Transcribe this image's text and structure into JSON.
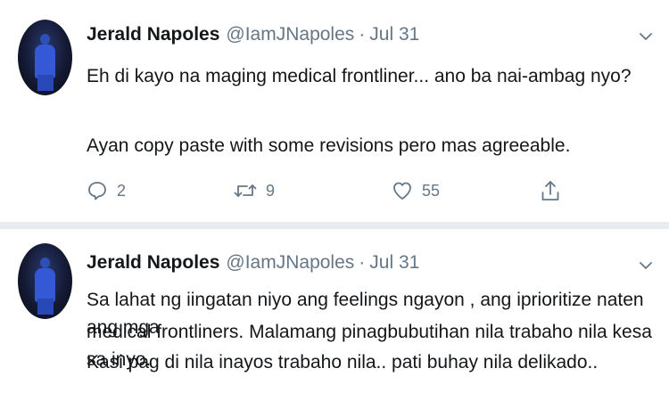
{
  "tweets": [
    {
      "author_name": "Jerald Napoles",
      "handle": "@IamJNapoles",
      "separator": "·",
      "date": "Jul 31",
      "lines": [
        "Eh di kayo na maging medical frontliner... ano ba nai-ambag nyo?",
        "Ayan copy paste with some revisions pero mas agreeable."
      ],
      "reply_count": "2",
      "retweet_count": "9",
      "like_count": "55"
    },
    {
      "author_name": "Jerald Napoles",
      "handle": "@IamJNapoles",
      "separator": "·",
      "date": "Jul 31",
      "lines": [
        "Sa lahat ng iingatan niyo ang feelings ngayon , ang iprioritize naten ang mga",
        "medical frontliners. Malamang pinagbubutihan nila trabaho nila kesa sa inyo.",
        "Kasi pag di nila inayos trabaho nila.. pati buhay nila delikado.."
      ]
    }
  ],
  "icons": {
    "reply": "reply-icon",
    "retweet": "retweet-icon",
    "like": "heart-icon",
    "share": "share-icon",
    "menu": "chevron-down-icon"
  },
  "colors": {
    "text": "#14171a",
    "secondary": "#657786",
    "separator": "#e6ecf0"
  }
}
